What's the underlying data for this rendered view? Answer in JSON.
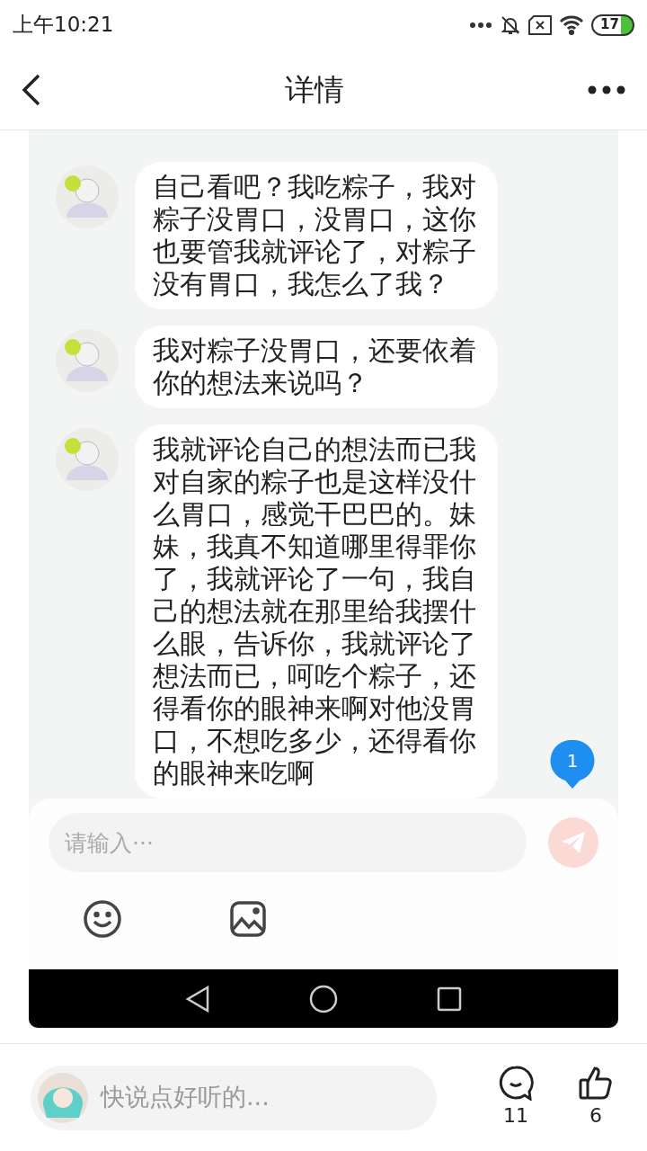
{
  "status_bar": {
    "time": "上午10:21",
    "battery": "17"
  },
  "header": {
    "title": "详情"
  },
  "chat": {
    "messages": [
      {
        "text": "自己看吧？我吃粽子，我对粽子没胃口，没胃口，这你也要管我就评论了，对粽子没有胃口，我怎么了我？"
      },
      {
        "text": "我对粽子没胃口，还要依着你的想法来说吗？"
      },
      {
        "text": "我就评论自己的想法而已我对自家的粽子也是这样没什么胃口，感觉干巴巴的。妹妹，我真不知道哪里得罪你了，我就评论了一句，我自己的想法就在那里给我摆什么眼，告诉你，我就评论了想法而已，呵吃个粽子，还得看你的眼神来啊对他没胃口，不想吃多少，还得看你的眼神来吃啊"
      }
    ],
    "unread_badge": "1"
  },
  "composer": {
    "placeholder": "请输入···"
  },
  "bottom_bar": {
    "placeholder": "快说点好听的...",
    "comment_count": "11",
    "like_count": "6"
  }
}
